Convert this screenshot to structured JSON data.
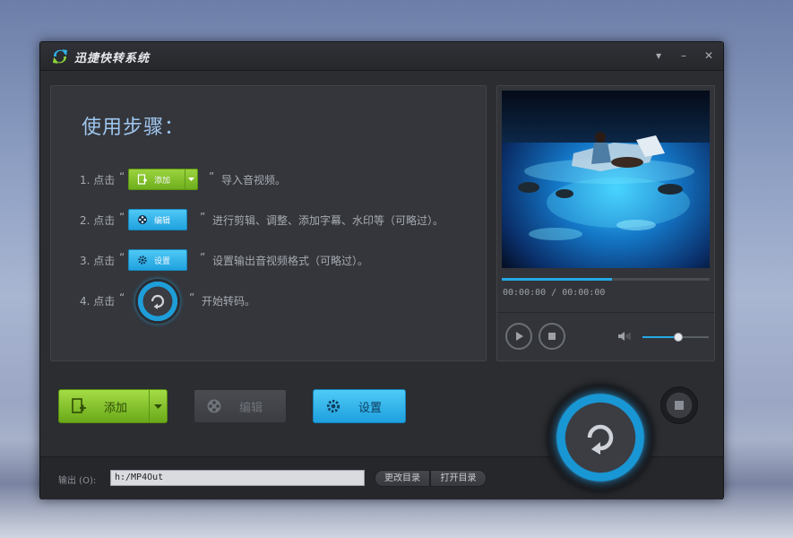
{
  "window": {
    "title": "迅捷快转系统",
    "controls": {
      "menu": "▾",
      "minimize": "–",
      "close": "✕"
    }
  },
  "steps": {
    "heading": "使用步骤：",
    "open_quote": "“",
    "close_quote": "”",
    "items": [
      {
        "num": "1. 点击",
        "button": "添加",
        "desc": "导入音视频。"
      },
      {
        "num": "2. 点击",
        "button": "编辑",
        "desc": "进行剪辑、调整、添加字幕、水印等（可略过）。"
      },
      {
        "num": "3. 点击",
        "button": "设置",
        "desc": "设置输出音视频格式（可略过）。"
      },
      {
        "num": "4. 点击",
        "button": "",
        "desc": "开始转码。"
      }
    ]
  },
  "player": {
    "time": "00:00:00 / 00:00:00",
    "progress": 0.53,
    "volume": 0.54
  },
  "actions": {
    "add_label": "添加",
    "edit_label": "编辑",
    "settings_label": "设置"
  },
  "output": {
    "label": "输出 (O):",
    "path": "h:/MP4Out",
    "change_dir": "更改目录",
    "open_dir": "打开目录"
  },
  "colors": {
    "accent_blue": "#1ea0de",
    "accent_green": "#7cbf24",
    "panel_bg": "#34363b",
    "window_bg": "#2b2d31"
  }
}
